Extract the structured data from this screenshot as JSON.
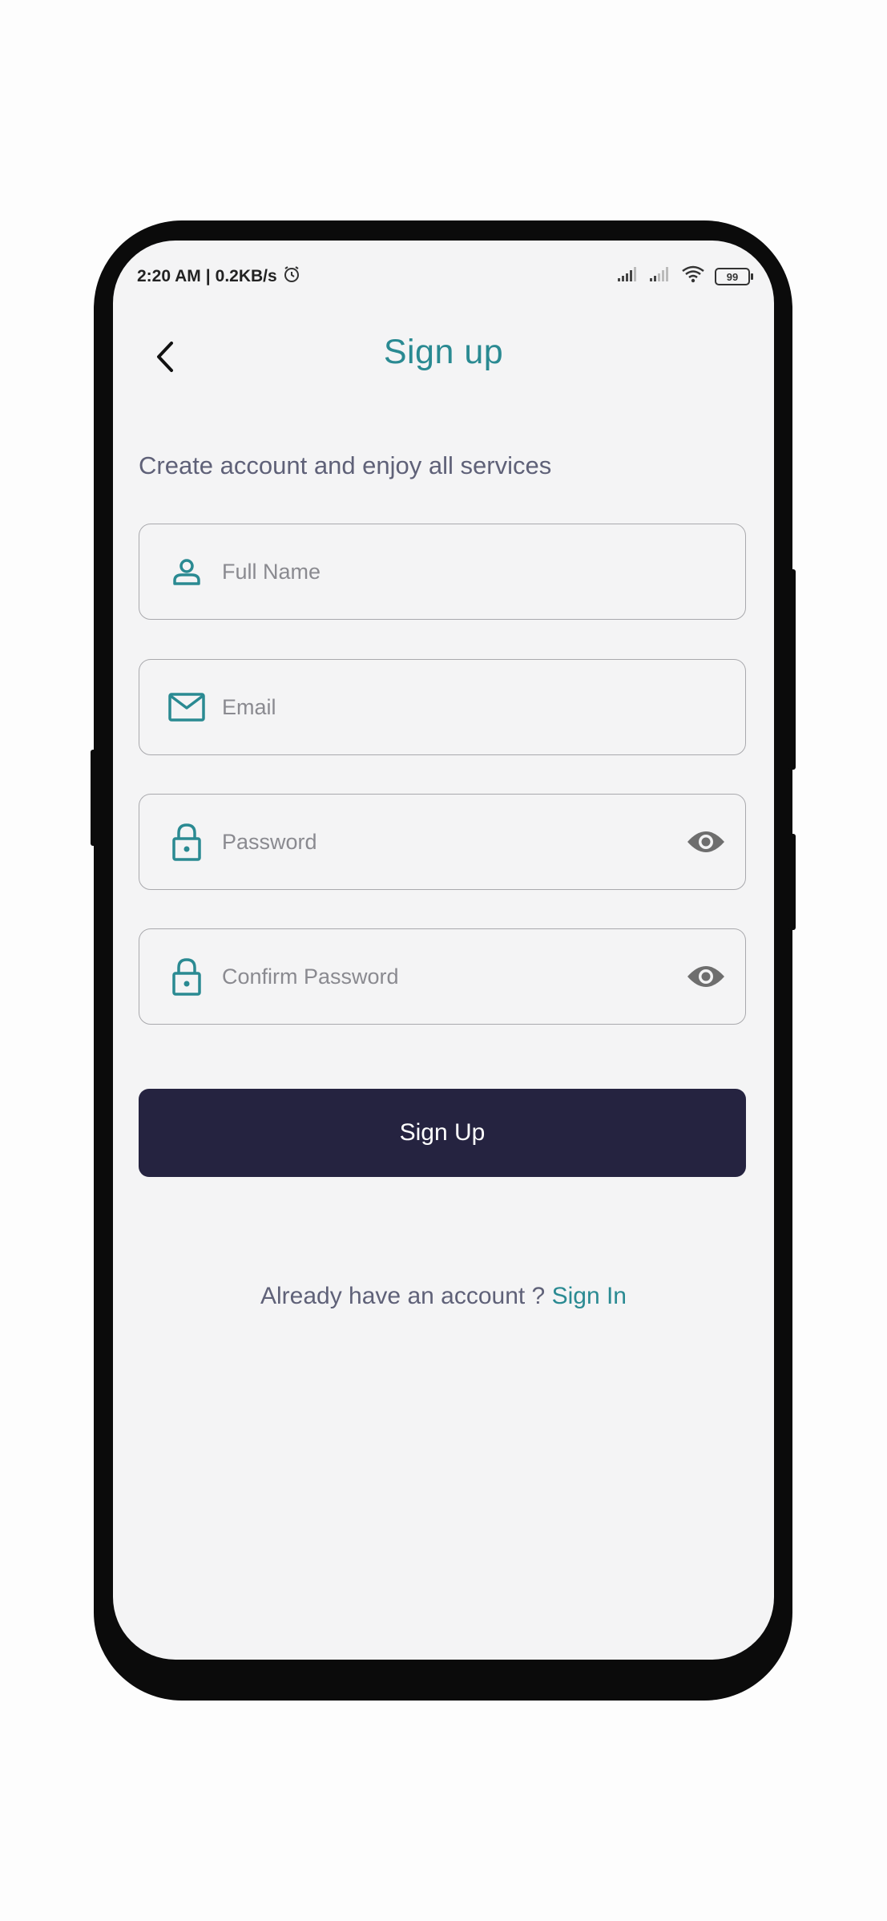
{
  "status_bar": {
    "time": "2:20 AM",
    "separator": "|",
    "net_speed": "0.2KB/s",
    "battery": "99",
    "icons": [
      "alarm-icon",
      "signal-icon",
      "signal-icon",
      "wifi-icon",
      "battery-icon"
    ]
  },
  "header": {
    "title": "Sign up",
    "back_icon": "chevron-left-icon"
  },
  "subtitle": "Create account and enjoy all services",
  "fields": {
    "full_name": {
      "placeholder": "Full Name",
      "value": "",
      "icon": "person-icon"
    },
    "email": {
      "placeholder": "Email",
      "value": "",
      "icon": "mail-icon"
    },
    "password": {
      "placeholder": "Password",
      "value": "",
      "icon": "lock-icon",
      "toggle_icon": "eye-icon"
    },
    "confirm_password": {
      "placeholder": "Confirm Password",
      "value": "",
      "icon": "lock-icon",
      "toggle_icon": "eye-icon"
    }
  },
  "signup_button": {
    "label": "Sign Up"
  },
  "footer": {
    "prompt": "Already have an account ?",
    "link": "Sign In"
  },
  "colors": {
    "accent": "#2a8a92",
    "button": "#252340",
    "text_muted": "#5f6178",
    "screen_bg": "#f4f4f5"
  }
}
